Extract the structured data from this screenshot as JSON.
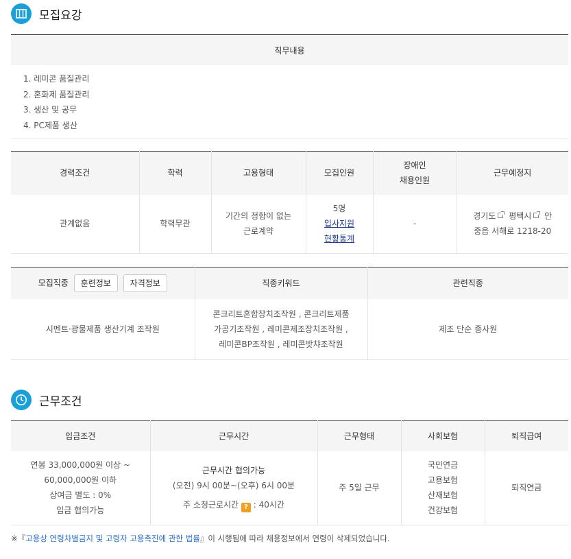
{
  "sections": {
    "recruit_title": "모집요강",
    "conditions_title": "근무조건"
  },
  "duty": {
    "header": "직무내용",
    "items": [
      "1. 레미콘 품질관리",
      "2. 혼화제 품질관리",
      "3. 생산 및 공무",
      "4. PC제품 생산"
    ]
  },
  "recruit_table": {
    "headers": {
      "experience": "경력조건",
      "education": "학력",
      "employment": "고용형태",
      "headcount": "모집인원",
      "disabled_line1": "장애인",
      "disabled_line2": "채용인원",
      "location": "근무예정지"
    },
    "values": {
      "experience": "관계없음",
      "education": "학력무관",
      "employment_line1": "기간의 정함이 없는",
      "employment_line2": "근로계약",
      "headcount": "5명",
      "apply_link": "입사지원",
      "stats_link": "현황통계",
      "disabled": "-",
      "loc_province": "경기도",
      "loc_city": "평택시",
      "loc_rest": "안",
      "loc_line2": "중읍 서해로 1218-20"
    }
  },
  "job_table": {
    "headers": {
      "job": "모집직종",
      "training_btn": "훈련정보",
      "license_btn": "자격정보",
      "keyword": "직종키워드",
      "related": "관련직종"
    },
    "values": {
      "job": "시멘트·광물제품 생산기계 조작원",
      "keyword_line1": "콘크리트혼합장치조작원 , 콘크리트제품",
      "keyword_line2": "가공기조작원 , 레미콘제조장치조작원 ,",
      "keyword_line3": "레미콘BP조작원 , 레미콘밧챠조작원",
      "related": "제조 단순 종사원"
    }
  },
  "cond_table": {
    "headers": {
      "wage": "임금조건",
      "hours": "근무시간",
      "work_type": "근무형태",
      "insurance": "사회보험",
      "severance": "퇴직급여"
    },
    "values": {
      "wage_line1": "연봉 33,000,000원 이상 ~",
      "wage_line2": "60,000,000원 이하",
      "wage_line3": "상여금 별도 : 0%",
      "wage_line4": "임금 협의가능",
      "hours_title": "근무시간 협의가능",
      "hours_detail": "(오전) 9시 00분~(오후) 6시 00분",
      "hours_weekly_label": "주 소정근로시간",
      "hours_weekly_badge": "?",
      "hours_weekly_value": ": 40시간",
      "work_type": "주 5일 근무",
      "insurance": [
        "국민연금",
        "고용보험",
        "산재보험",
        "건강보험"
      ],
      "severance": "퇴직연금"
    }
  },
  "note": {
    "prefix": "※『",
    "law": "고용상 연령차별금지 및 고령자 고용촉진에 관한 법률",
    "suffix": "』이 시행됨에 따라 채용정보에서 연령이 삭제되었습니다."
  },
  "colors": {
    "accent": "#1a9fd9",
    "link": "#1d3a8a",
    "badge": "#f0a020"
  }
}
